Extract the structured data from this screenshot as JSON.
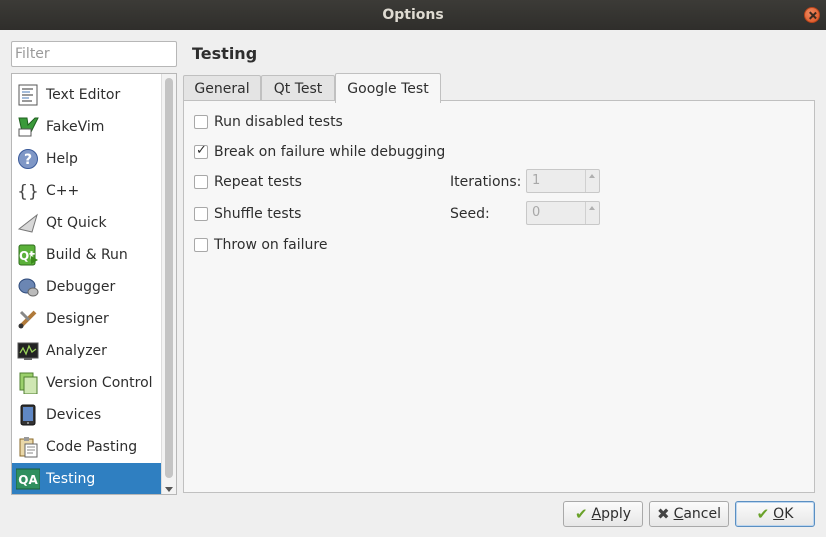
{
  "window": {
    "title": "Options"
  },
  "filter": {
    "placeholder": "Filter",
    "value": ""
  },
  "categories": [
    {
      "label": "Text Editor",
      "icon": "text-editor-icon"
    },
    {
      "label": "FakeVim",
      "icon": "fakevim-icon"
    },
    {
      "label": "Help",
      "icon": "help-icon"
    },
    {
      "label": "C++",
      "icon": "cpp-braces-icon"
    },
    {
      "label": "Qt Quick",
      "icon": "qt-quick-icon"
    },
    {
      "label": "Build & Run",
      "icon": "build-run-icon"
    },
    {
      "label": "Debugger",
      "icon": "debugger-icon"
    },
    {
      "label": "Designer",
      "icon": "designer-icon"
    },
    {
      "label": "Analyzer",
      "icon": "analyzer-icon"
    },
    {
      "label": "Version Control",
      "icon": "version-control-icon"
    },
    {
      "label": "Devices",
      "icon": "devices-icon"
    },
    {
      "label": "Code Pasting",
      "icon": "code-pasting-icon"
    },
    {
      "label": "Testing",
      "icon": "testing-qa-icon",
      "icon_text": "QA",
      "selected": true
    }
  ],
  "page": {
    "title": "Testing"
  },
  "tabs": [
    {
      "label": "General"
    },
    {
      "label": "Qt Test"
    },
    {
      "label": "Google Test",
      "active": true
    }
  ],
  "options": [
    {
      "label": "Run disabled tests",
      "checked": false
    },
    {
      "label": "Break on failure while debugging",
      "checked": true
    },
    {
      "label": "Repeat tests",
      "checked": false
    },
    {
      "label": "Shuffle tests",
      "checked": false
    },
    {
      "label": "Throw on failure",
      "checked": false
    }
  ],
  "iterations": {
    "label": "Iterations:",
    "value": "1"
  },
  "seed": {
    "label": "Seed:",
    "value": "0"
  },
  "buttons": {
    "apply_mnemonic": "A",
    "apply_rest": "pply",
    "cancel_mnemonic": "C",
    "cancel_rest": "ancel",
    "ok_mnemonic": "O",
    "ok_rest": "K"
  },
  "colors": {
    "selection": "#2f7fc1",
    "accent_green": "#6aa22a",
    "titlebar": "#3c3b37"
  }
}
